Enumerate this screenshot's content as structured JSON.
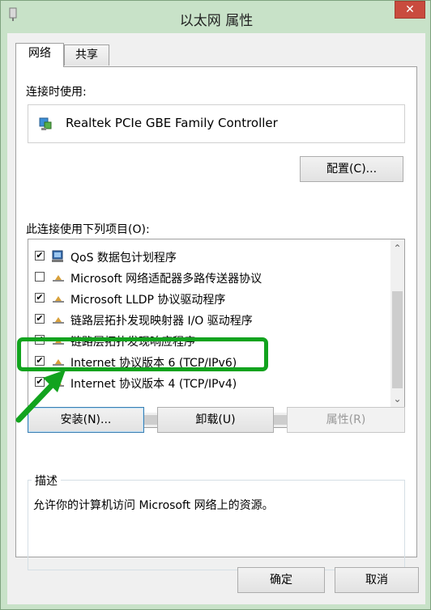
{
  "window": {
    "title": "以太网 属性",
    "close_label": "✕"
  },
  "tabs": [
    {
      "label": "网络",
      "active": true
    },
    {
      "label": "共享",
      "active": false
    }
  ],
  "connection": {
    "label": "连接时使用:",
    "adapter": "Realtek PCIe GBE Family Controller",
    "configure_button": "配置(C)..."
  },
  "items_section": {
    "label": "此连接使用下列项目(O):",
    "items": [
      {
        "label": "QoS 数据包计划程序",
        "checked": true,
        "icon": "qos-icon"
      },
      {
        "label": "Microsoft 网络适配器多路传送器协议",
        "checked": false,
        "icon": "protocol-icon"
      },
      {
        "label": "Microsoft LLDP 协议驱动程序",
        "checked": true,
        "icon": "protocol-icon"
      },
      {
        "label": "链路层拓扑发现映射器 I/O 驱动程序",
        "checked": true,
        "icon": "protocol-icon"
      },
      {
        "label": "链路层拓扑发现响应程序",
        "checked": true,
        "icon": "protocol-icon"
      },
      {
        "label": "Internet 协议版本 6 (TCP/IPv6)",
        "checked": true,
        "icon": "protocol-icon"
      },
      {
        "label": "Internet 协议版本 4 (TCP/IPv4)",
        "checked": true,
        "icon": "protocol-icon",
        "highlighted": true
      }
    ]
  },
  "actions": {
    "install": "安装(N)...",
    "uninstall": "卸载(U)",
    "properties": "属性(R)"
  },
  "description": {
    "legend": "描述",
    "text": "允许你的计算机访问 Microsoft 网络上的资源。"
  },
  "footer": {
    "ok": "确定",
    "cancel": "取消"
  },
  "colors": {
    "highlight": "#12a31e",
    "frame": "#c8e2c8",
    "close": "#c94b3e"
  }
}
